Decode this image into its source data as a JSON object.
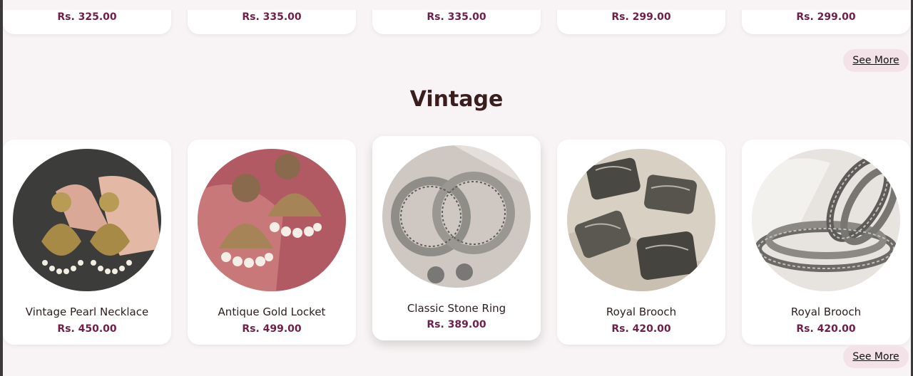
{
  "top_row": {
    "prices": [
      "Rs. 325.00",
      "Rs. 335.00",
      "Rs. 335.00",
      "Rs. 299.00",
      "Rs. 299.00"
    ],
    "see_more": "See More"
  },
  "vintage": {
    "title": "Vintage",
    "products": [
      {
        "name": "Vintage Pearl Necklace",
        "price": "Rs. 450.00",
        "image": "gold-chandbali-earrings"
      },
      {
        "name": "Antique Gold Locket",
        "price": "Rs. 499.00",
        "image": "gold-jhumka-earrings"
      },
      {
        "name": "Classic Stone Ring",
        "price": "Rs. 389.00",
        "image": "silver-hoop-jhumka-earrings"
      },
      {
        "name": "Royal Brooch",
        "price": "Rs. 420.00",
        "image": "oxidised-silver-bangles"
      },
      {
        "name": "Royal Brooch",
        "price": "Rs. 420.00",
        "image": "stacked-silver-bangles"
      }
    ],
    "see_more": "See More"
  },
  "colors": {
    "price": "#6e1f47",
    "background": "#f8f4f5",
    "see_more_bg": "#f3e3e8"
  }
}
